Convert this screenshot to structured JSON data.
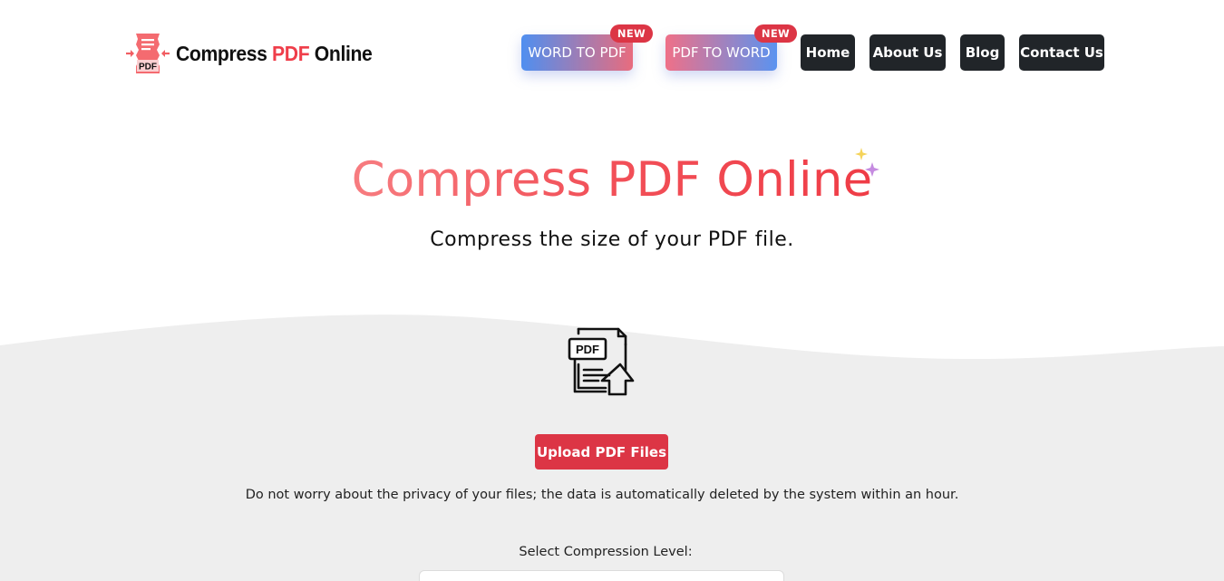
{
  "brand": {
    "logo_text_main": "Compress ",
    "logo_text_accent": "PDF",
    "logo_text_tail": " Online",
    "logo_icon_text": "PDF",
    "accent_color": "#ef3e4a"
  },
  "nav": {
    "items": [
      {
        "label": "WORD TO PDF",
        "badge": "NEW",
        "style": "gradient"
      },
      {
        "label": "PDF TO WORD",
        "badge": "NEW",
        "style": "gradient"
      },
      {
        "label": "Home",
        "style": "dark"
      },
      {
        "label": "About Us",
        "style": "dark"
      },
      {
        "label": "Blog",
        "style": "dark"
      },
      {
        "label": "Contact Us",
        "style": "dark"
      }
    ]
  },
  "hero": {
    "title": "Compress PDF Online",
    "subtitle": "Compress the size of your PDF file."
  },
  "upload": {
    "icon": "pdf-upload-icon",
    "icon_text": "PDF",
    "button_label": "Upload PDF Files",
    "privacy_note": "Do not worry about the privacy of your files; the data is automatically deleted by the system within an hour.",
    "compression_label": "Select Compression Level:",
    "compression_value": ""
  },
  "colors": {
    "dark_button": "#212529",
    "danger": "#dc3545",
    "section_bg": "#eeeeee"
  }
}
